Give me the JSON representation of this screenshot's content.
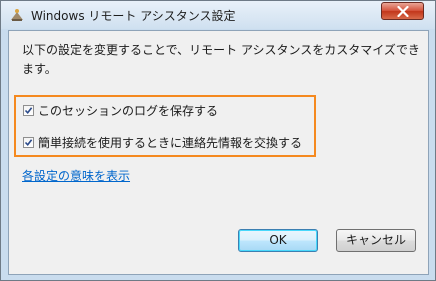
{
  "window": {
    "title": "Windows リモート アシスタンス設定"
  },
  "description": "以下の設定を変更することで、リモート アシスタンスをカスタマイズできます。",
  "options": [
    {
      "label": "このセッションのログを保存する",
      "checked": true
    },
    {
      "label": "簡単接続を使用するときに連絡先情報を交換する",
      "checked": true
    }
  ],
  "link": "各設定の意味を表示",
  "buttons": {
    "ok": "OK",
    "cancel": "キャンセル"
  },
  "colors": {
    "highlight_border": "#f5891f",
    "link": "#0066cc",
    "close_button": "#c2361b"
  },
  "icons": [
    "app-icon",
    "close-icon",
    "checkmark-icon"
  ]
}
